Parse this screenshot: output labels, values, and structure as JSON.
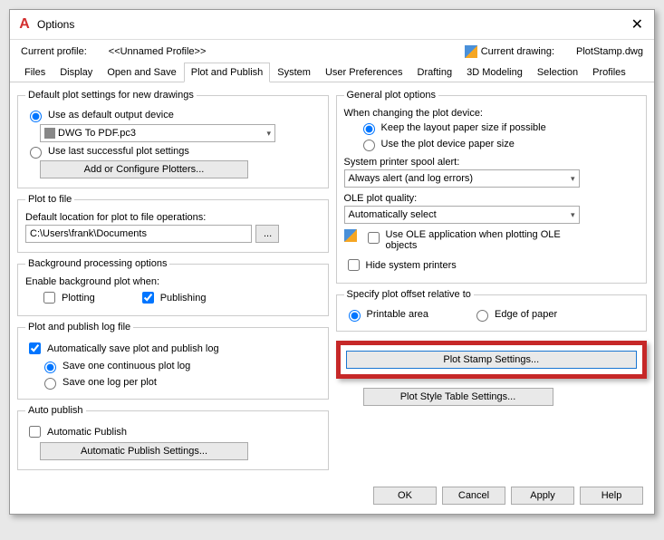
{
  "window": {
    "title": "Options"
  },
  "profile": {
    "label": "Current profile:",
    "name": "<<Unnamed Profile>>",
    "drawing_label": "Current drawing:",
    "drawing_name": "PlotStamp.dwg"
  },
  "tabs": [
    "Files",
    "Display",
    "Open and Save",
    "Plot and Publish",
    "System",
    "User Preferences",
    "Drafting",
    "3D Modeling",
    "Selection",
    "Profiles"
  ],
  "active_tab": 3,
  "left": {
    "default_plot": {
      "legend": "Default plot settings for new drawings",
      "opt1": "Use as default output device",
      "device": "DWG To PDF.pc3",
      "opt2": "Use last successful plot settings",
      "btn": "Add or Configure Plotters..."
    },
    "plot_to_file": {
      "legend": "Plot to file",
      "label": "Default location for plot to file operations:",
      "path": "C:\\Users\\frank\\Documents",
      "browse": "..."
    },
    "bgproc": {
      "legend": "Background processing options",
      "label": "Enable background plot when:",
      "opt1": "Plotting",
      "opt2": "Publishing"
    },
    "logfile": {
      "legend": "Plot and publish log file",
      "auto": "Automatically save plot and publish log",
      "opt1": "Save one continuous plot log",
      "opt2": "Save one log per plot"
    },
    "autopub": {
      "legend": "Auto publish",
      "opt": "Automatic Publish",
      "btn": "Automatic Publish Settings..."
    }
  },
  "right": {
    "general": {
      "legend": "General plot options",
      "change_label": "When changing the plot device:",
      "opt1": "Keep the layout paper size if possible",
      "opt2": "Use the plot device paper size",
      "spool_label": "System printer spool alert:",
      "spool_value": "Always alert (and log errors)",
      "ole_label": "OLE plot quality:",
      "ole_value": "Automatically select",
      "ole_check": "Use OLE application when plotting OLE objects",
      "hide": "Hide system printers"
    },
    "offset": {
      "legend": "Specify plot offset relative to",
      "opt1": "Printable area",
      "opt2": "Edge of paper"
    },
    "plot_stamp_btn": "Plot Stamp Settings...",
    "plot_style_btn": "Plot Style Table Settings..."
  },
  "footer": {
    "ok": "OK",
    "cancel": "Cancel",
    "apply": "Apply",
    "help": "Help"
  }
}
